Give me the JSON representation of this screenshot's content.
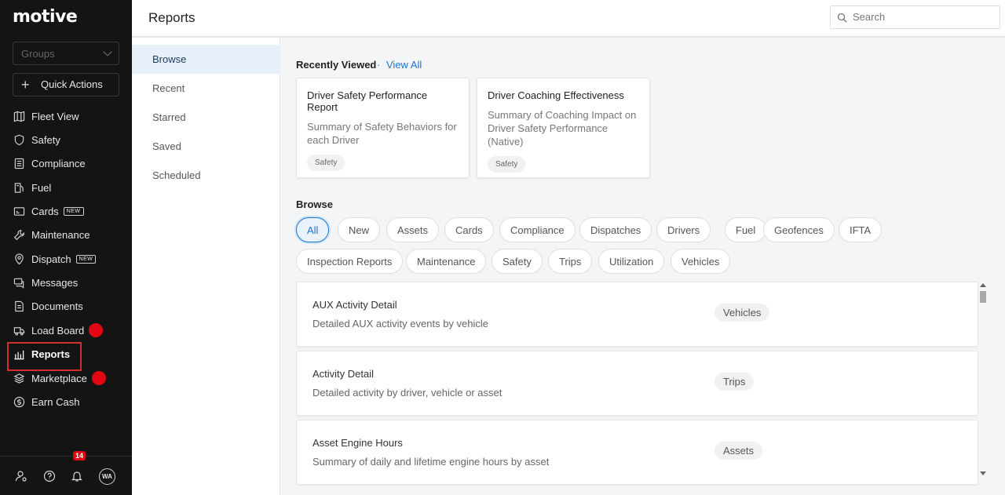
{
  "brand": {
    "logo": "motive"
  },
  "sidebar": {
    "groups_placeholder": "Groups",
    "quick_actions": "Quick Actions",
    "items": [
      {
        "label": "Fleet View",
        "icon": "map-icon"
      },
      {
        "label": "Safety",
        "icon": "shield-icon"
      },
      {
        "label": "Compliance",
        "icon": "document-list-icon"
      },
      {
        "label": "Fuel",
        "icon": "fuel-pump-icon"
      },
      {
        "label": "Cards",
        "icon": "card-icon",
        "badge": "NEW"
      },
      {
        "label": "Maintenance",
        "icon": "wrench-icon"
      },
      {
        "label": "Dispatch",
        "icon": "location-pin-icon",
        "badge": "NEW"
      },
      {
        "label": "Messages",
        "icon": "chat-icon"
      },
      {
        "label": "Documents",
        "icon": "document-icon"
      },
      {
        "label": "Load Board",
        "icon": "truck-icon"
      },
      {
        "label": "Reports",
        "icon": "bar-chart-icon"
      },
      {
        "label": "Marketplace",
        "icon": "layers-icon"
      },
      {
        "label": "Earn Cash",
        "icon": "dollar-circle-icon"
      }
    ],
    "active_item": "Reports",
    "footer": {
      "notification_count": "14",
      "avatar_initials": "WA"
    }
  },
  "header": {
    "title": "Reports",
    "search_placeholder": "Search"
  },
  "subnav": {
    "items": [
      "Browse",
      "Recent",
      "Starred",
      "Saved",
      "Scheduled"
    ],
    "active": "Browse"
  },
  "recently_viewed": {
    "title": "Recently Viewed",
    "separator": "·",
    "view_all": "View All",
    "cards": [
      {
        "title": "Driver Safety Performance Report",
        "description": "Summary of Safety Behaviors for each Driver",
        "tag": "Safety"
      },
      {
        "title": "Driver Coaching Effectiveness",
        "description": "Summary of Coaching Impact on Driver Safety Performance (Native)",
        "tag": "Safety"
      }
    ]
  },
  "browse": {
    "title": "Browse",
    "filters": [
      "All",
      "New",
      "Assets",
      "Cards",
      "Compliance",
      "Dispatches",
      "Drivers",
      "Fuel",
      "Geofences",
      "IFTA",
      "Inspection Reports",
      "Maintenance",
      "Safety",
      "Trips",
      "Utilization",
      "Vehicles"
    ],
    "active_filter": "All",
    "reports": [
      {
        "title": "AUX Activity Detail",
        "description": "Detailed AUX activity events by vehicle",
        "tag": "Vehicles"
      },
      {
        "title": "Activity Detail",
        "description": "Detailed activity by driver, vehicle or asset",
        "tag": "Trips"
      },
      {
        "title": "Asset Engine Hours",
        "description": "Summary of daily and lifetime engine hours by asset",
        "tag": "Assets"
      }
    ]
  },
  "colors": {
    "sidebar_bg": "#141414",
    "accent": "#1d74d0",
    "alert_red": "#e30613",
    "highlight_border": "#d03030"
  }
}
